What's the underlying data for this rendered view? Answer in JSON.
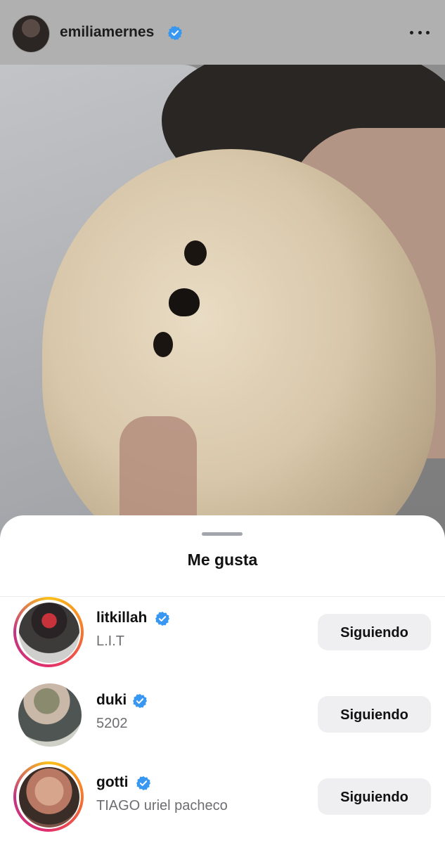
{
  "header": {
    "username": "emiliamernes",
    "verified_icon": "verified-badge-icon",
    "more_icon": "more-options-icon"
  },
  "post": {
    "image_subject": "photo"
  },
  "likes_sheet": {
    "title": "Me gusta",
    "users": [
      {
        "username": "litkillah",
        "subtitle": "L.I.T",
        "button": "Siguiendo",
        "verified": true,
        "story_ring": true
      },
      {
        "username": "duki",
        "subtitle": "5202",
        "button": "Siguiendo",
        "verified": true,
        "story_ring": false
      },
      {
        "username": "gotti",
        "subtitle": "TIAGO uriel pacheco",
        "button": "Siguiendo",
        "verified": true,
        "story_ring": true
      }
    ]
  },
  "colors": {
    "verified_blue": "#3897f0",
    "button_bg": "#efeff1"
  }
}
